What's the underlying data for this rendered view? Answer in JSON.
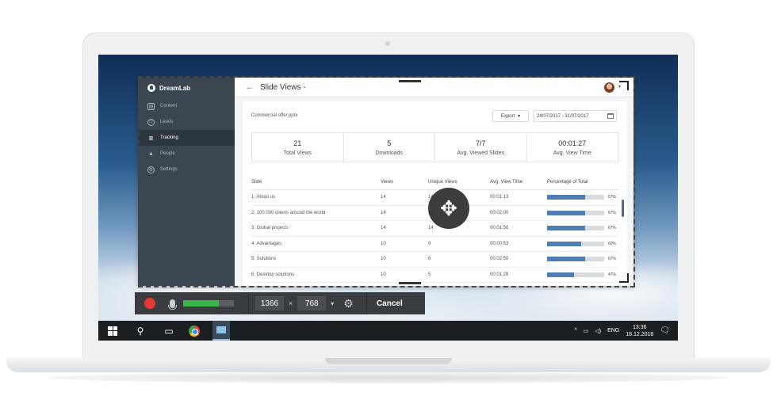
{
  "app": {
    "brand": "DreamLab",
    "page_title": "Slide Views -",
    "sidebar": {
      "items": [
        {
          "label": "Content",
          "icon": "content-icon",
          "active": false
        },
        {
          "label": "Leads",
          "icon": "leads-icon",
          "active": false
        },
        {
          "label": "Tracking",
          "icon": "tracking-icon",
          "active": true
        },
        {
          "label": "People",
          "icon": "people-icon",
          "active": false
        },
        {
          "label": "Settings",
          "icon": "settings-icon",
          "active": false
        }
      ]
    },
    "file_name": "Commercial offer.pptx",
    "export_label": "Export",
    "date_range": "24/07/2017 - 31/07/2017",
    "stats": [
      {
        "value": "21",
        "label": "Total Views"
      },
      {
        "value": "5",
        "label": "Downloads"
      },
      {
        "value": "7/7",
        "label": "Avg. Viewed Slides"
      },
      {
        "value": "00:01:27",
        "label": "Avg. View Time"
      }
    ],
    "table": {
      "headers": [
        "Slide",
        "Views",
        "Unique Views",
        "Avg. View Time",
        "Percentage of Total"
      ],
      "rows": [
        {
          "slide": "1. About us",
          "views": "14",
          "unique": "14",
          "time": "00:01:13",
          "pct": 67
        },
        {
          "slide": "2. 100 000 clients around the world",
          "views": "14",
          "unique": "14",
          "time": "00:02:00",
          "pct": 67
        },
        {
          "slide": "3. Global projects",
          "views": "14",
          "unique": "14",
          "time": "00:01:56",
          "pct": 67
        },
        {
          "slide": "4. Advantages",
          "views": "10",
          "unique": "9",
          "time": "00:00:53",
          "pct": 60
        },
        {
          "slide": "5. Solutions",
          "views": "10",
          "unique": "6",
          "time": "00:02:50",
          "pct": 67
        },
        {
          "slide": "6. Desktop solutions",
          "views": "10",
          "unique": "5",
          "time": "00:01:28",
          "pct": 47
        }
      ]
    }
  },
  "recorder": {
    "mic_level": 0.7,
    "width": "1366",
    "times": "×",
    "height": "768",
    "cancel_label": "Cancel"
  },
  "taskbar": {
    "language": "ENG",
    "time": "13:36",
    "date": "18.12.2018"
  },
  "colors": {
    "record": "#e53935",
    "bar": "#4f7fb0",
    "sidebar": "#3c4651"
  }
}
